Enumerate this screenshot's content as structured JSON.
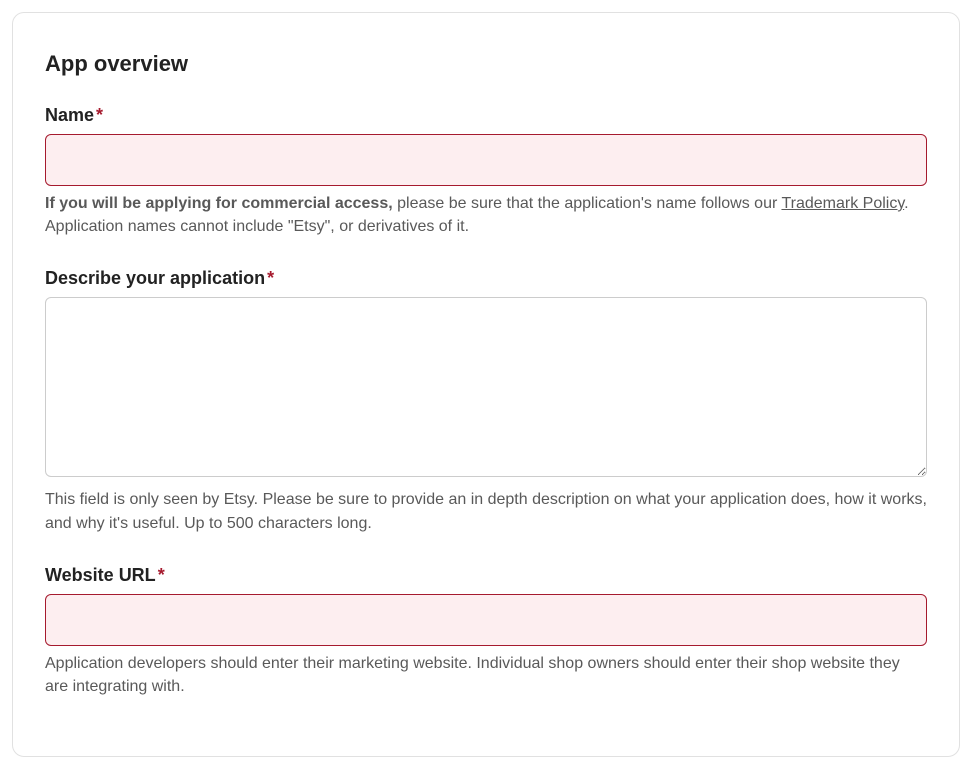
{
  "section": {
    "title": "App overview"
  },
  "fields": {
    "name": {
      "label": "Name",
      "value": "",
      "helper_bold": "If you will be applying for commercial access,",
      "helper_part1": " please be sure that the application's name follows our ",
      "helper_link": "Trademark Policy",
      "helper_part2": ". Application names cannot include \"Etsy\", or derivatives of it."
    },
    "description": {
      "label": "Describe your application",
      "value": "",
      "helper": "This field is only seen by Etsy. Please be sure to provide an in depth description on what your application does, how it works, and why it's useful. Up to 500 characters long."
    },
    "website": {
      "label": "Website URL",
      "value": "",
      "helper": "Application developers should enter their marketing website. Individual shop owners should enter their shop website they are integrating with."
    }
  },
  "required_marker": "*"
}
